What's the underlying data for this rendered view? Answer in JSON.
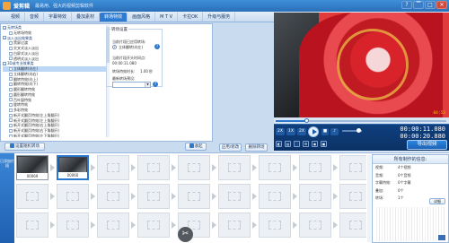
{
  "app": {
    "name": "爱剪辑",
    "tagline": "最易用、强大的视频剪辑软件",
    "window_buttons": [
      "?",
      "▔",
      "□",
      "✕"
    ]
  },
  "tabs": [
    {
      "label": "视频",
      "active": false
    },
    {
      "label": "音频",
      "active": false
    },
    {
      "label": "字幕特效",
      "active": false
    },
    {
      "label": "叠加素材",
      "active": false
    },
    {
      "label": "转场特效",
      "active": true
    },
    {
      "label": "画面风格",
      "active": false
    },
    {
      "label": "M T V",
      "active": false
    },
    {
      "label": "卡拉OK",
      "active": false
    },
    {
      "label": "升级与服务",
      "active": false
    }
  ],
  "effects_tree": [
    {
      "label": "无转场类",
      "kind": "group"
    },
    {
      "label": "无转场特效",
      "kind": "child"
    },
    {
      "label": "淡入淡出效果类",
      "kind": "group"
    },
    {
      "label": "黑屏过渡",
      "kind": "child"
    },
    {
      "label": "交叉式淡入淡出",
      "kind": "child"
    },
    {
      "label": "白屏式淡入淡出",
      "kind": "child"
    },
    {
      "label": "透明式淡入淡出",
      "kind": "child"
    },
    {
      "label": "3D或专业效果类",
      "kind": "group"
    },
    {
      "label": "立体翻转(向左)",
      "kind": "child",
      "selected": true
    },
    {
      "label": "立体翻转(向右)",
      "kind": "child"
    },
    {
      "label": "翻转特效(向上)",
      "kind": "child"
    },
    {
      "label": "翻转特效(向下)",
      "kind": "child"
    },
    {
      "label": "圆形翻转特效",
      "kind": "child"
    },
    {
      "label": "圆形翻转特效",
      "kind": "child"
    },
    {
      "label": "百叶窗特效",
      "kind": "child"
    },
    {
      "label": "旋转特效",
      "kind": "child"
    },
    {
      "label": "多彩特效",
      "kind": "child"
    },
    {
      "label": "新开式翻页特效(左上角翻开)",
      "kind": "child"
    },
    {
      "label": "新开式翻页特效(左上角翻开)",
      "kind": "child"
    },
    {
      "label": "新开式翻页特效(右上角翻开)",
      "kind": "child"
    },
    {
      "label": "新开式翻页特效(右下角翻开)",
      "kind": "child"
    },
    {
      "label": "新开式翻页特效(左下角翻开)",
      "kind": "child"
    }
  ],
  "transition_settings": {
    "title": "转场设置",
    "current_label": "当前片段已应用转场:",
    "current_value": "立体翻转(向左)",
    "start_label": "当前片段开头时间点:",
    "start_value": "00:00:11.080",
    "duration_label": "转场特效时长:",
    "duration_value": "1.00",
    "duration_unit": "秒",
    "preset_label": "最新转场预设:",
    "preset_value": ""
  },
  "effects_buttons": {
    "random": "设置随机转场",
    "collapse": "收起",
    "apply": "应用/修改",
    "delete": "删除转场"
  },
  "player": {
    "timestamp": "04:53",
    "speed_buttons": [
      "2X",
      "1X",
      "2X"
    ],
    "timecode_current": "00:00:11.080",
    "timecode_total": "00:00:20.880",
    "export": "导出视频",
    "progress_fraction": 0.18
  },
  "timeline": {
    "label": "已添加片段",
    "clips": [
      {
        "caption": "00069"
      },
      {
        "caption": "00060"
      }
    ]
  },
  "properties": {
    "title": "所有制作的信息:",
    "rows": [
      {
        "k": "视频:",
        "v": "4个视频"
      },
      {
        "k": "音频:",
        "v": "0个音频"
      },
      {
        "k": "字幕特效:",
        "v": "0个字幕"
      },
      {
        "k": "叠加:",
        "v": "0个"
      },
      {
        "k": "转场:",
        "v": "1个"
      }
    ],
    "edit_label": "详细"
  },
  "colors": {
    "accent": "#2f7bd0",
    "title_bar": "#2a6fb8",
    "export_button": "#1c63b8"
  }
}
